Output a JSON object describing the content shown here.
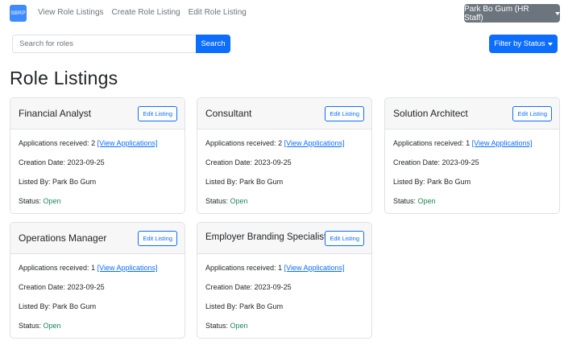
{
  "nav": {
    "logo_text": "SBRP",
    "links": [
      "View Role Listings",
      "Create Role Listing",
      "Edit Role Listing"
    ],
    "user_label": "Park Bo Gum (HR Staff)"
  },
  "search": {
    "placeholder": "Search for roles",
    "button_label": "Search"
  },
  "filter": {
    "label": "Filter by Status"
  },
  "page_title": "Role Listings",
  "labels": {
    "edit": "Edit Listing",
    "applications": "Applications received:",
    "view_applications": "[View Applications]",
    "creation_date": "Creation Date:",
    "listed_by": "Listed By:",
    "status": "Status:"
  },
  "listings": [
    {
      "title": "Financial Analyst",
      "applications": "2",
      "creation_date": "2023-09-25",
      "listed_by": "Park Bo Gum",
      "status": "Open"
    },
    {
      "title": "Consultant",
      "applications": "2",
      "creation_date": "2023-09-25",
      "listed_by": "Park Bo Gum",
      "status": "Open"
    },
    {
      "title": "Solution Architect",
      "applications": "1",
      "creation_date": "2023-09-25",
      "listed_by": "Park Bo Gum",
      "status": "Open"
    },
    {
      "title": "Operations Manager",
      "applications": "1",
      "creation_date": "2023-09-25",
      "listed_by": "Park Bo Gum",
      "status": "Open"
    },
    {
      "title": "Employer Branding Specialist",
      "applications": "1",
      "creation_date": "2023-09-25",
      "listed_by": "Park Bo Gum",
      "status": "Open"
    }
  ],
  "colors": {
    "primary": "#0d6efd",
    "secondary": "#6c757d",
    "success": "#198754"
  }
}
